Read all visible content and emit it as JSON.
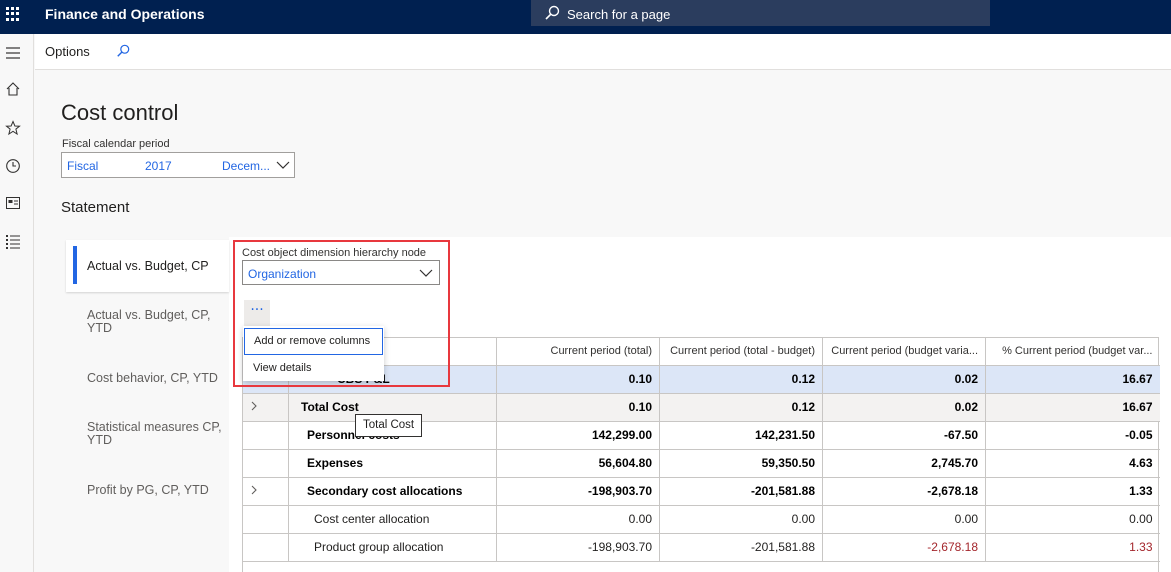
{
  "topbar": {
    "app_name": "Finance and Operations",
    "search_placeholder": "Search for a page"
  },
  "actionbar": {
    "options_label": "Options"
  },
  "page": {
    "title": "Cost control"
  },
  "fiscal_period": {
    "label": "Fiscal calendar period",
    "calendar": "Fiscal",
    "year": "2017",
    "period": "Decem..."
  },
  "statement": {
    "heading": "Statement"
  },
  "tabs": [
    {
      "label": "Actual vs. Budget, CP"
    },
    {
      "label": "Actual vs. Budget, CP, YTD"
    },
    {
      "label": "Cost behavior, CP, YTD"
    },
    {
      "label": "Statistical measures CP, YTD"
    },
    {
      "label": "Profit by PG, CP, YTD"
    }
  ],
  "hierarchy": {
    "label": "Cost object dimension hierarchy node",
    "value": "Organization"
  },
  "more_button": {
    "label": "···"
  },
  "context_menu": {
    "items": [
      "Add or remove columns",
      "View details"
    ]
  },
  "tooltip": {
    "text": "Total Cost"
  },
  "table": {
    "columns": [
      "Current period (total)",
      "Current period (total - budget)",
      "Current period (budget varia...",
      "% Current period (budget var..."
    ],
    "rows": [
      {
        "name": "CBS P&L",
        "values": [
          "0.10",
          "0.12",
          "0.02",
          "16.67"
        ]
      },
      {
        "name": "Total Cost",
        "values": [
          "0.10",
          "0.12",
          "0.02",
          "16.67"
        ]
      },
      {
        "name": "Personnel costs",
        "values": [
          "142,299.00",
          "142,231.50",
          "-67.50",
          "-0.05"
        ]
      },
      {
        "name": "Expenses",
        "values": [
          "56,604.80",
          "59,350.50",
          "2,745.70",
          "4.63"
        ]
      },
      {
        "name": "Secondary cost allocations",
        "values": [
          "-198,903.70",
          "-201,581.88",
          "-2,678.18",
          "1.33"
        ]
      },
      {
        "name": "Cost center allocation",
        "values": [
          "0.00",
          "0.00",
          "0.00",
          "0.00"
        ]
      },
      {
        "name": "Product group allocation",
        "values": [
          "-198,903.70",
          "-201,581.88",
          "-2,678.18",
          "1.33"
        ]
      }
    ]
  },
  "colors": {
    "topbar": "#002050",
    "accent": "#2266e3",
    "negative": "#a4262c",
    "highlight_box": "#e8383e",
    "selected_row": "#dce6f7"
  }
}
